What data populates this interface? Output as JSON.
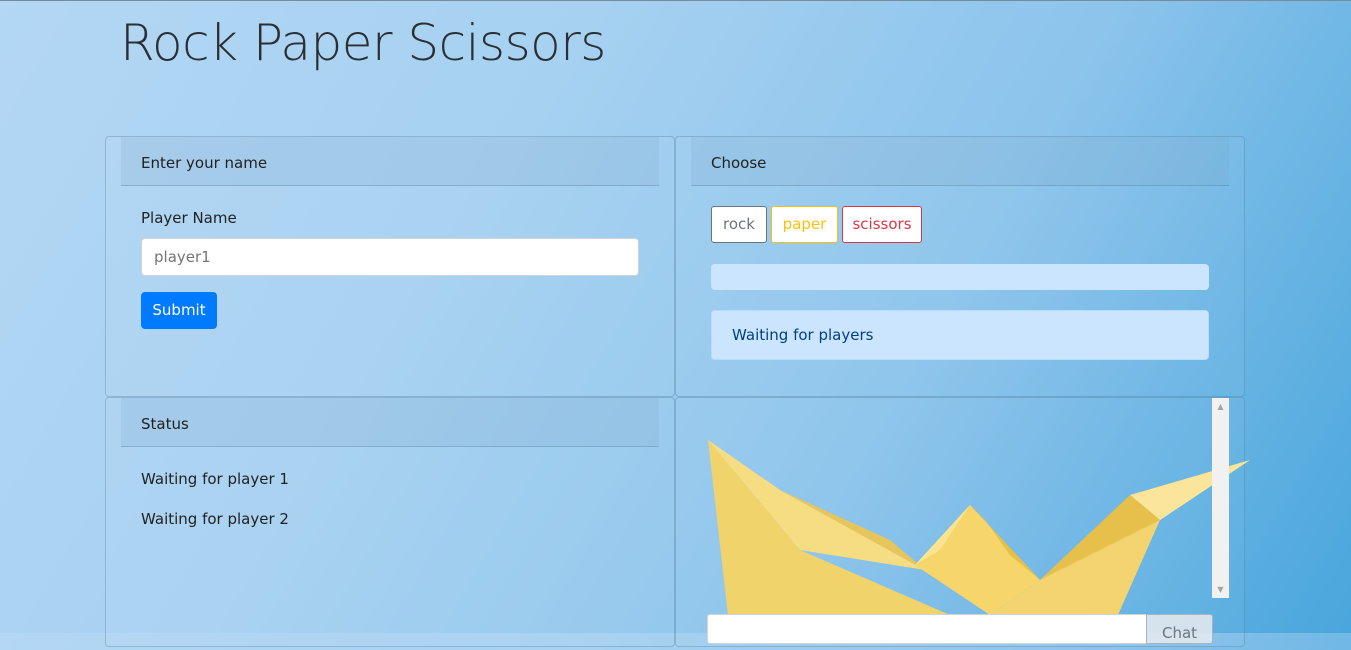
{
  "page": {
    "title": "Rock Paper Scissors"
  },
  "name_card": {
    "header": "Enter your name",
    "field_label": "Player Name",
    "input_placeholder": "player1",
    "submit_label": "Submit"
  },
  "choose_card": {
    "header": "Choose",
    "choices": [
      {
        "label": "rock",
        "color": "#6c757d"
      },
      {
        "label": "paper",
        "color": "#ffc107"
      },
      {
        "label": "scissors",
        "color": "#dc3545"
      }
    ],
    "result_text": "",
    "alert_text": "Waiting for players"
  },
  "status_card": {
    "header": "Status",
    "lines": [
      "Waiting for player 1",
      "Waiting for player 2"
    ]
  },
  "chat_card": {
    "input_value": "",
    "send_label": "Chat",
    "image": "paper-boat-image"
  },
  "colors": {
    "primary": "#007bff",
    "alert_bg": "#cce5ff",
    "alert_text": "#004085"
  }
}
